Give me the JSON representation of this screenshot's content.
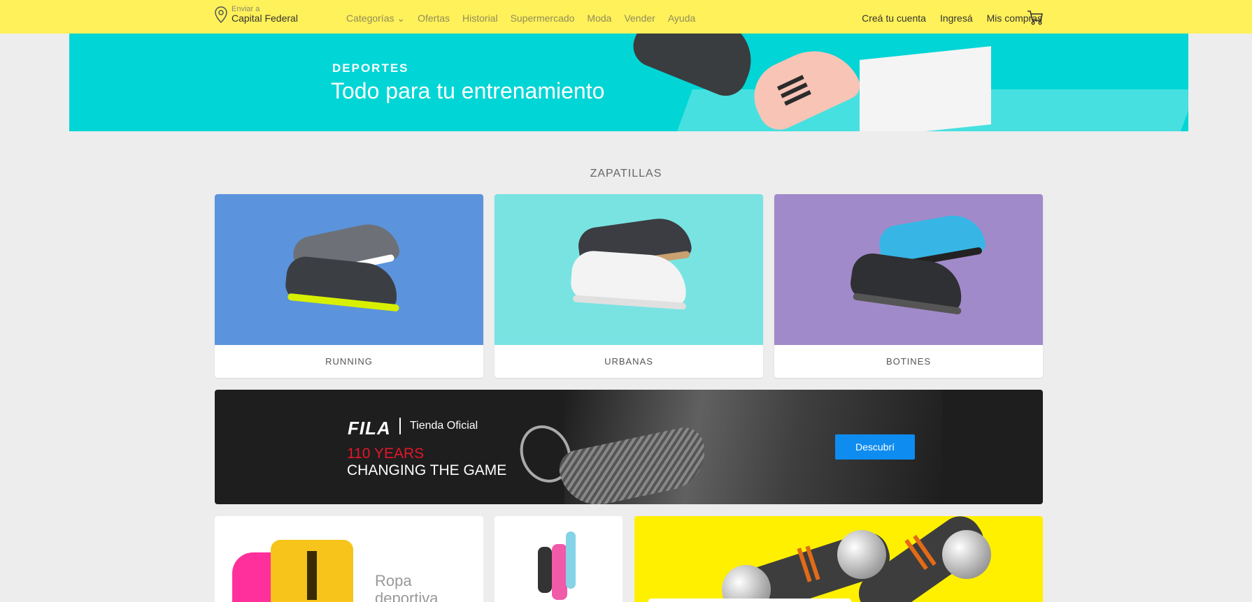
{
  "header": {
    "location_label": "Enviar a",
    "location_city": "Capital Federal",
    "nav": [
      "Categorías",
      "Ofertas",
      "Historial",
      "Supermercado",
      "Moda",
      "Vender",
      "Ayuda"
    ],
    "account": [
      "Creá tu cuenta",
      "Ingresá",
      "Mis compras"
    ]
  },
  "hero": {
    "category": "DEPORTES",
    "title": "Todo para tu entrenamiento",
    "background": "#02d5d5"
  },
  "section": {
    "title": "ZAPATILLAS",
    "cards": [
      {
        "label": "RUNNING",
        "color": "#5b93dc"
      },
      {
        "label": "URBANAS",
        "color": "#79e3e2"
      },
      {
        "label": "BOTINES",
        "color": "#a18ac9"
      }
    ]
  },
  "fila": {
    "logo": "FILA",
    "store": "Tienda Oficial",
    "years": "110 YEARS",
    "tagline": "CHANGING THE GAME",
    "button": "Descubrí"
  },
  "bottom": {
    "ropa": "Ropa deportiva"
  },
  "colors": {
    "header": "#fff159",
    "accent_blue": "#0e8cf0",
    "fila_red": "#e4162a"
  }
}
